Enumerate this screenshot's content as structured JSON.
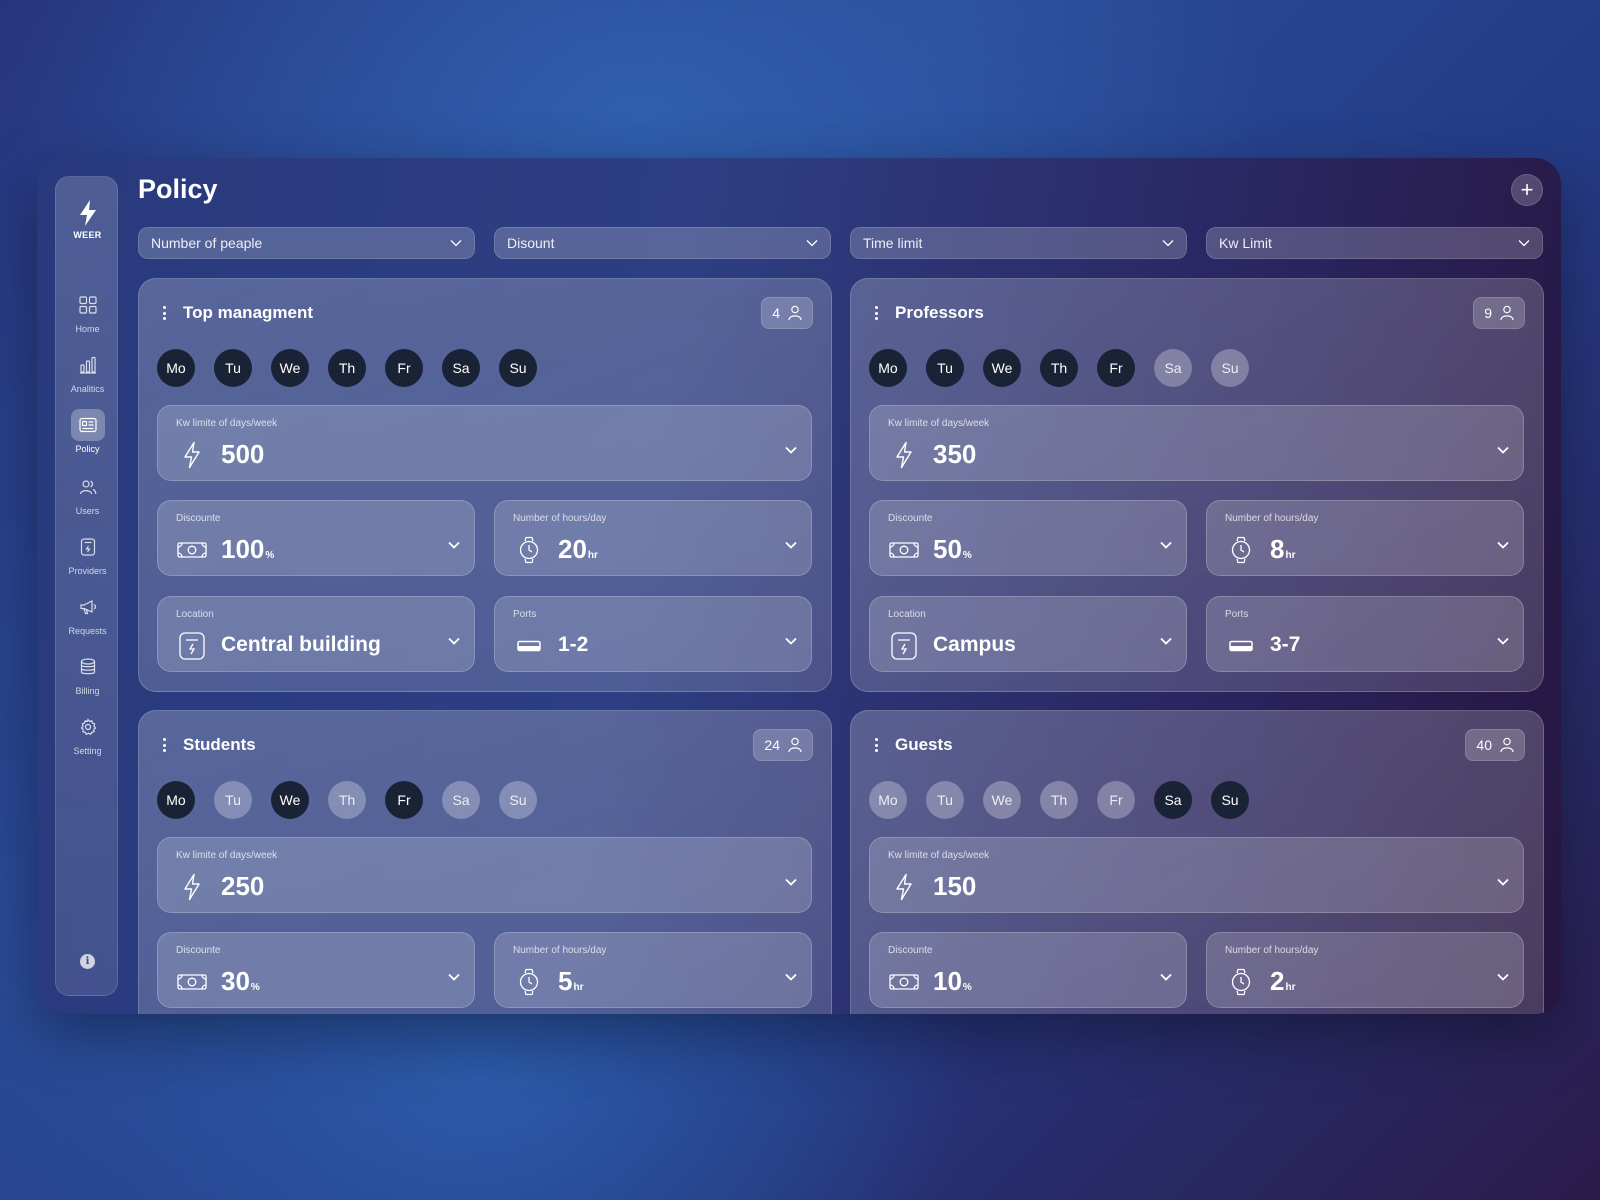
{
  "app": {
    "logo_text": "WEER"
  },
  "page": {
    "title": "Policy"
  },
  "sidebar": {
    "items": [
      {
        "label": "Home",
        "icon": "grid-icon"
      },
      {
        "label": "Analitics",
        "icon": "bar-chart-icon"
      },
      {
        "label": "Policy",
        "icon": "policy-card-icon",
        "active": true
      },
      {
        "label": "Users",
        "icon": "users-icon"
      },
      {
        "label": "Providers",
        "icon": "provider-icon"
      },
      {
        "label": "Requests",
        "icon": "megaphone-icon"
      },
      {
        "label": "Billing",
        "icon": "database-icon"
      },
      {
        "label": "Setting",
        "icon": "gear-icon"
      }
    ]
  },
  "filters": [
    {
      "label": "Number of peaple"
    },
    {
      "label": "Disount"
    },
    {
      "label": "Time limit"
    },
    {
      "label": "Kw Limit"
    }
  ],
  "labels": {
    "kw": "Kw limite of days/week",
    "discount": "Discounte",
    "hours": "Number of hours/day",
    "location": "Location",
    "ports": "Ports",
    "percent_unit": "%",
    "hour_unit": "hr"
  },
  "days": [
    "Mo",
    "Tu",
    "We",
    "Th",
    "Fr",
    "Sa",
    "Su"
  ],
  "cards": [
    {
      "title": "Top managment",
      "count": "4",
      "days_active": [
        true,
        true,
        true,
        true,
        true,
        true,
        true
      ],
      "kw": "500",
      "discount": "100",
      "hours": "20",
      "location": "Central building",
      "ports": "1-2"
    },
    {
      "title": "Professors",
      "count": "9",
      "days_active": [
        true,
        true,
        true,
        true,
        true,
        false,
        false
      ],
      "kw": "350",
      "discount": "50",
      "hours": "8",
      "location": "Campus",
      "ports": "3-7"
    },
    {
      "title": "Students",
      "count": "24",
      "days_active": [
        true,
        false,
        true,
        false,
        true,
        false,
        false
      ],
      "kw": "250",
      "discount": "30",
      "hours": "5",
      "location": "",
      "ports": ""
    },
    {
      "title": "Guests",
      "count": "40",
      "days_active": [
        false,
        false,
        false,
        false,
        false,
        true,
        true
      ],
      "kw": "150",
      "discount": "10",
      "hours": "2",
      "location": "",
      "ports": ""
    }
  ],
  "colors": {
    "day_active": "#1a2235",
    "accent": "#ffffff"
  }
}
